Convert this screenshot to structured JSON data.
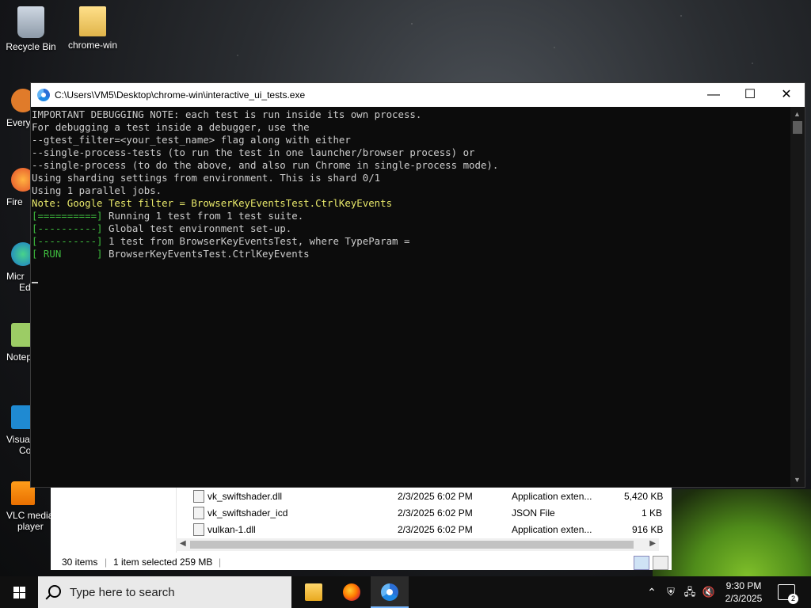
{
  "desktop": {
    "icons": [
      {
        "label": "Recycle Bin"
      },
      {
        "label": "chrome-win"
      }
    ],
    "side_icons": [
      {
        "label": "Every"
      },
      {
        "label": "Fire"
      },
      {
        "label": "Micr"
      },
      {
        "label": "Ed"
      },
      {
        "label": "Notep"
      },
      {
        "label": "Visual"
      },
      {
        "label": "Co"
      },
      {
        "label": "VLC media"
      },
      {
        "label": "player"
      }
    ]
  },
  "console": {
    "title": "C:\\Users\\VM5\\Desktop\\chrome-win\\interactive_ui_tests.exe",
    "minimize": "—",
    "maximize": "☐",
    "close": "✕",
    "lines": [
      "IMPORTANT DEBUGGING NOTE: each test is run inside its own process.",
      "For debugging a test inside a debugger, use the",
      "--gtest_filter=<your_test_name> flag along with either",
      "--single-process-tests (to run the test in one launcher/browser process) or",
      "--single-process (to do the above, and also run Chrome in single-process mode).",
      "Using sharding settings from environment. This is shard 0/1",
      "Using 1 parallel jobs."
    ],
    "note_line": "Note: Google Test filter = BrowserKeyEventsTest.CtrlKeyEvents",
    "gtest_lines": [
      {
        "tag": "[==========]",
        "text": " Running 1 test from 1 test suite."
      },
      {
        "tag": "[----------]",
        "text": " Global test environment set-up."
      },
      {
        "tag": "[----------]",
        "text": " 1 test from BrowserKeyEventsTest, where TypeParam ="
      },
      {
        "tag": "[ RUN      ]",
        "text": " BrowserKeyEventsTest.CtrlKeyEvents"
      }
    ]
  },
  "explorer": {
    "rows": [
      {
        "name": "vk_swiftshader.dll",
        "date": "2/3/2025 6:02 PM",
        "type": "Application exten...",
        "size": "5,420 KB"
      },
      {
        "name": "vk_swiftshader_icd",
        "date": "2/3/2025 6:02 PM",
        "type": "JSON File",
        "size": "1 KB"
      },
      {
        "name": "vulkan-1.dll",
        "date": "2/3/2025 6:02 PM",
        "type": "Application exten...",
        "size": "916 KB"
      }
    ],
    "status": {
      "items": "30 items",
      "selected": "1 item selected  259 MB"
    }
  },
  "taskbar": {
    "search_placeholder": "Type here to search",
    "time": "9:30 PM",
    "date": "2/3/2025",
    "notifications": "2"
  }
}
